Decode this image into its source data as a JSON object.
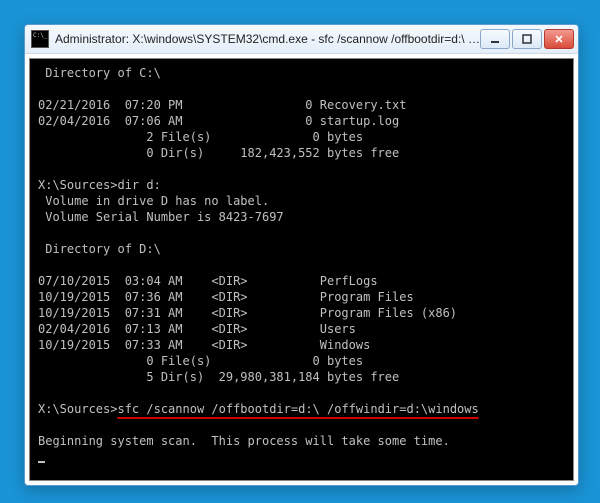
{
  "titlebar": {
    "icon_name": "cmd-icon",
    "title": "Administrator: X:\\windows\\SYSTEM32\\cmd.exe - sfc  /scannow /offbootdir=d:\\ /offwindi..."
  },
  "lines": {
    "l01": " Directory of C:\\",
    "l02": "",
    "l03": "02/21/2016  07:20 PM                 0 Recovery.txt",
    "l04": "02/04/2016  07:06 AM                 0 startup.log",
    "l05": "               2 File(s)              0 bytes",
    "l06": "               0 Dir(s)     182,423,552 bytes free",
    "l07": "",
    "l08_prompt": "X:\\Sources>",
    "l08_cmd": "dir d:",
    "l09": " Volume in drive D has no label.",
    "l10": " Volume Serial Number is 8423-7697",
    "l11": "",
    "l12": " Directory of D:\\",
    "l13": "",
    "l14": "07/10/2015  03:04 AM    <DIR>          PerfLogs",
    "l15": "10/19/2015  07:36 AM    <DIR>          Program Files",
    "l16": "10/19/2015  07:31 AM    <DIR>          Program Files (x86)",
    "l17": "02/04/2016  07:13 AM    <DIR>          Users",
    "l18": "10/19/2015  07:33 AM    <DIR>          Windows",
    "l19": "               0 File(s)              0 bytes",
    "l20": "               5 Dir(s)  29,980,381,184 bytes free",
    "l21": "",
    "l22_prompt": "X:\\Sources>",
    "l22_cmd": "sfc /scannow /offbootdir=d:\\ /offwindir=d:\\windows",
    "l23": "",
    "l24": "Beginning system scan.  This process will take some time."
  }
}
